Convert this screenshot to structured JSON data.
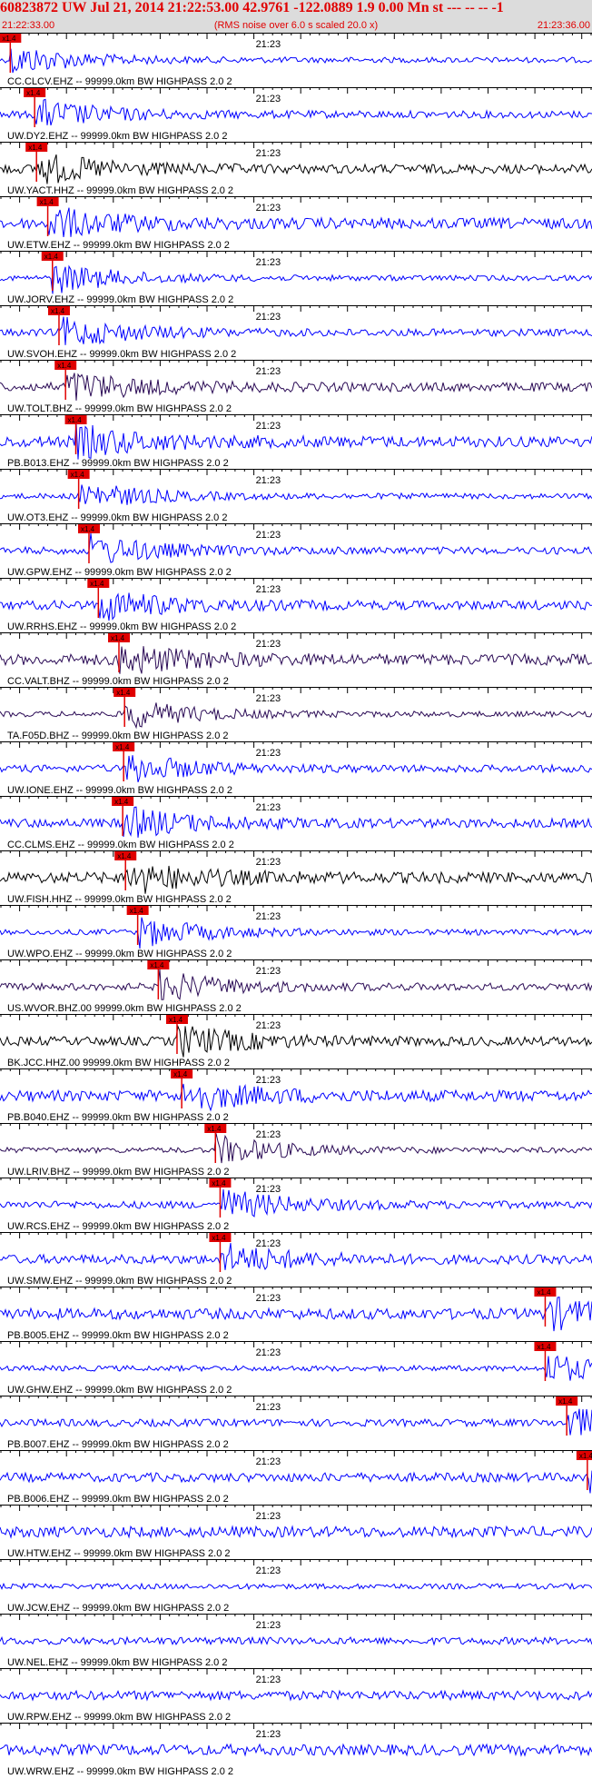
{
  "header": {
    "title": "60823872 UW Jul 21, 2014 21:22:53.00   42.9761 -122.0889  1.9 0.00 Mn st --- -- --   -1",
    "subtitle": "(RMS noise over 6.0 s scaled 20.0 x)",
    "time_start": "21:22:33.00",
    "time_end": "21:23:36.00"
  },
  "colors": {
    "title": "#e00000",
    "header_bg": "#dcdcdc",
    "trace_blue": "#0000ff",
    "trace_black": "#000000",
    "trace_purple": "#2a0a55",
    "pick": "#e00000",
    "axis": "#000000"
  },
  "chart_data": {
    "type": "line",
    "title": "60823872 UW Jul 21, 2014 21:22:53.00   42.9761 -122.0889  1.9 0.00 Mn st --- -- --   -1",
    "xlim": [
      "21:22:33.00",
      "21:23:36.00"
    ],
    "minute_label": "21:23",
    "pick_label": "x1.4",
    "grid": false,
    "traces": [
      {
        "label": "CC.CLCV.EHZ -- 99999.0km BW  HIGHPASS  2.0  2",
        "pick_time": "21:22:34.0",
        "color": "blue"
      },
      {
        "label": "UW.DY2.EHZ -- 99999.0km BW  HIGHPASS  2.0  2",
        "pick_time": "21:22:36.6",
        "color": "blue"
      },
      {
        "label": "UW.YACT.HHZ -- 99999.0km BW  HIGHPASS  2.0  2",
        "pick_time": "21:22:36.8",
        "color": "black"
      },
      {
        "label": "UW.ETW.EHZ -- 99999.0km BW  HIGHPASS  2.0  2",
        "pick_time": "21:22:38.0",
        "color": "blue"
      },
      {
        "label": "UW.JORV.EHZ -- 99999.0km BW  HIGHPASS  2.0  2",
        "pick_time": "21:22:38.5",
        "color": "blue"
      },
      {
        "label": "UW.SVOH.EHZ -- 99999.0km BW  HIGHPASS  2.0  2",
        "pick_time": "21:22:39.2",
        "color": "blue"
      },
      {
        "label": "UW.TOLT.BHZ -- 99999.0km BW  HIGHPASS  2.0  2",
        "pick_time": "21:22:39.9",
        "color": "purple"
      },
      {
        "label": "PB.B013.EHZ -- 99999.0km BW  HIGHPASS  2.0  2",
        "pick_time": "21:22:41.0",
        "color": "blue"
      },
      {
        "label": "UW.OT3.EHZ -- 99999.0km BW  HIGHPASS  2.0  2",
        "pick_time": "21:22:41.3",
        "color": "blue"
      },
      {
        "label": "UW.GPW.EHZ -- 99999.0km BW  HIGHPASS  2.0  2",
        "pick_time": "21:22:42.4",
        "color": "blue"
      },
      {
        "label": "UW.RRHS.EHZ -- 99999.0km BW  HIGHPASS  2.0  2",
        "pick_time": "21:22:43.4",
        "color": "blue"
      },
      {
        "label": "CC.VALT.BHZ -- 99999.0km BW  HIGHPASS  2.0  2",
        "pick_time": "21:22:45.6",
        "color": "purple"
      },
      {
        "label": "TA.F05D.BHZ -- 99999.0km BW  HIGHPASS  2.0  2",
        "pick_time": "21:22:46.2",
        "color": "purple"
      },
      {
        "label": "UW.IONE.EHZ -- 99999.0km BW  HIGHPASS  2.0  2",
        "pick_time": "21:22:46.1",
        "color": "blue"
      },
      {
        "label": "CC.CLMS.EHZ -- 99999.0km BW  HIGHPASS  2.0  2",
        "pick_time": "21:22:46.0",
        "color": "blue"
      },
      {
        "label": "UW.FISH.HHZ -- 99999.0km BW  HIGHPASS  2.0  2",
        "pick_time": "21:22:46.3",
        "color": "black"
      },
      {
        "label": "UW.WPO.EHZ -- 99999.0km BW  HIGHPASS  2.0  2",
        "pick_time": "21:22:47.6",
        "color": "blue"
      },
      {
        "label": "US.WVOR.BHZ.00 99999.0km BW  HIGHPASS  2.0  2",
        "pick_time": "21:22:49.8",
        "color": "purple"
      },
      {
        "label": "BK.JCC.HHZ.00 99999.0km BW  HIGHPASS  2.0  2",
        "pick_time": "21:22:51.8",
        "color": "black"
      },
      {
        "label": "PB.B040.EHZ -- 99999.0km BW  HIGHPASS  2.0  2",
        "pick_time": "21:22:52.3",
        "color": "blue"
      },
      {
        "label": "UW.LRIV.BHZ -- 99999.0km BW  HIGHPASS  2.0  2",
        "pick_time": "21:22:55.9",
        "color": "purple"
      },
      {
        "label": "UW.RCS.EHZ -- 99999.0km BW  HIGHPASS  2.0  2",
        "pick_time": "21:22:56.4",
        "color": "blue"
      },
      {
        "label": "UW.SMW.EHZ -- 99999.0km BW  HIGHPASS  2.0  2",
        "pick_time": "21:22:56.4",
        "color": "blue"
      },
      {
        "label": "PB.B005.EHZ -- 99999.0km BW  HIGHPASS  2.0  2",
        "pick_time": "21:23:31.1",
        "color": "blue"
      },
      {
        "label": "UW.GHW.EHZ -- 99999.0km BW  HIGHPASS  2.0  2",
        "pick_time": "21:23:31.1",
        "color": "blue"
      },
      {
        "label": "PB.B007.EHZ -- 99999.0km BW  HIGHPASS  2.0  2",
        "pick_time": "21:23:33.4",
        "color": "blue"
      },
      {
        "label": "PB.B006.EHZ -- 99999.0km BW  HIGHPASS  2.0  2",
        "pick_time": "21:23:35.6",
        "color": "blue"
      },
      {
        "label": "UW.HTW.EHZ -- 99999.0km BW  HIGHPASS  2.0  2",
        "pick_time": null,
        "color": "blue"
      },
      {
        "label": "UW.JCW.EHZ -- 99999.0km BW  HIGHPASS  2.0  2",
        "pick_time": null,
        "color": "blue"
      },
      {
        "label": "UW.NEL.EHZ -- 99999.0km BW  HIGHPASS  2.0  2",
        "pick_time": null,
        "color": "blue"
      },
      {
        "label": "UW.RPW.EHZ -- 99999.0km BW  HIGHPASS  2.0  2",
        "pick_time": null,
        "color": "blue"
      },
      {
        "label": "UW.WRW.EHZ -- 99999.0km BW  HIGHPASS  2.0  2",
        "pick_time": null,
        "color": "blue"
      }
    ]
  }
}
